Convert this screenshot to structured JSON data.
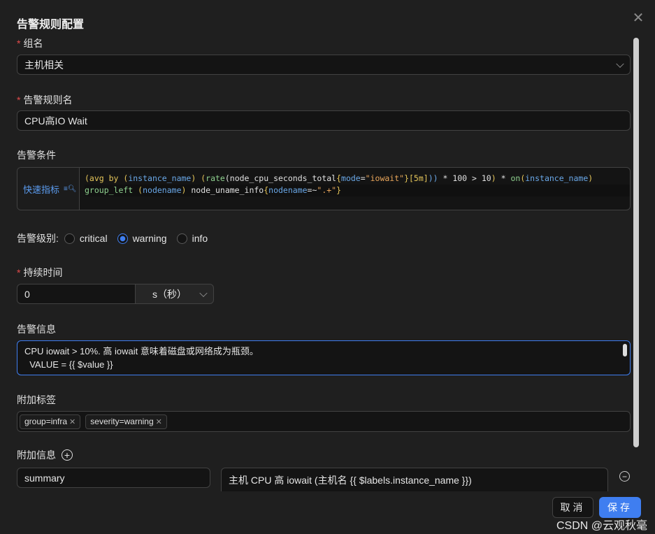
{
  "dialog": {
    "title": "告警规则配置"
  },
  "group": {
    "label": "组名",
    "value": "主机相关"
  },
  "rule_name": {
    "label": "告警规则名",
    "value": "CPU高IO Wait"
  },
  "condition": {
    "label": "告警条件",
    "quick_metrics": "快速指标",
    "line1": [
      {
        "t": "(avg by ",
        "c": "y"
      },
      {
        "t": "(",
        "c": "y"
      },
      {
        "t": "instance_name",
        "c": "b"
      },
      {
        "t": ") ",
        "c": "y"
      },
      {
        "t": "(",
        "c": "y"
      },
      {
        "t": "rate",
        "c": "g"
      },
      {
        "t": "(node_cpu_seconds_total",
        "c": "w"
      },
      {
        "t": "{",
        "c": "y"
      },
      {
        "t": "mode",
        "c": "b"
      },
      {
        "t": "=",
        "c": "w"
      },
      {
        "t": "\"iowait\"",
        "c": "o"
      },
      {
        "t": "}",
        "c": "y"
      },
      {
        "t": "[5m]",
        "c": "y"
      },
      {
        "t": "))",
        "c": "b"
      },
      {
        "t": " * 100 > 10",
        "c": "w"
      },
      {
        "t": ")",
        "c": "y"
      },
      {
        "t": " * ",
        "c": "w"
      },
      {
        "t": "on",
        "c": "g"
      },
      {
        "t": "(",
        "c": "y"
      },
      {
        "t": "instance_name",
        "c": "b"
      },
      {
        "t": ")",
        "c": "y"
      }
    ],
    "line2": [
      {
        "t": "group_left ",
        "c": "g"
      },
      {
        "t": "(",
        "c": "y"
      },
      {
        "t": "nodename",
        "c": "b"
      },
      {
        "t": ")",
        "c": "y"
      },
      {
        "t": " node_uname_info",
        "c": "w"
      },
      {
        "t": "{",
        "c": "y"
      },
      {
        "t": "nodename",
        "c": "b"
      },
      {
        "t": "=~",
        "c": "w"
      },
      {
        "t": "\".+\"",
        "c": "o"
      },
      {
        "t": "}",
        "c": "y"
      }
    ]
  },
  "severity": {
    "label": "告警级别:",
    "options": [
      {
        "label": "critical",
        "checked": false
      },
      {
        "label": "warning",
        "checked": true
      },
      {
        "label": "info",
        "checked": false
      }
    ]
  },
  "duration": {
    "label": "持续时间",
    "value": "0",
    "unit": "s（秒）"
  },
  "message": {
    "label": "告警信息",
    "line1": "CPU iowait > 10%. 高 iowait 意味着磁盘或网络成为瓶颈。",
    "line2": "  VALUE = {{ $value }}"
  },
  "labels": {
    "label": "附加标签",
    "tags": [
      "group=infra",
      "severity=warning"
    ]
  },
  "annotations": {
    "label": "附加信息",
    "key": "summary",
    "value": "主机 CPU 高 iowait (主机名 {{ $labels.instance_name }})"
  },
  "footer": {
    "cancel": "取消",
    "save": "保存"
  },
  "watermark": "CSDN @云观秋毫",
  "colors": {
    "primary": "#3f7ef0",
    "background": "#1f1f1f"
  }
}
